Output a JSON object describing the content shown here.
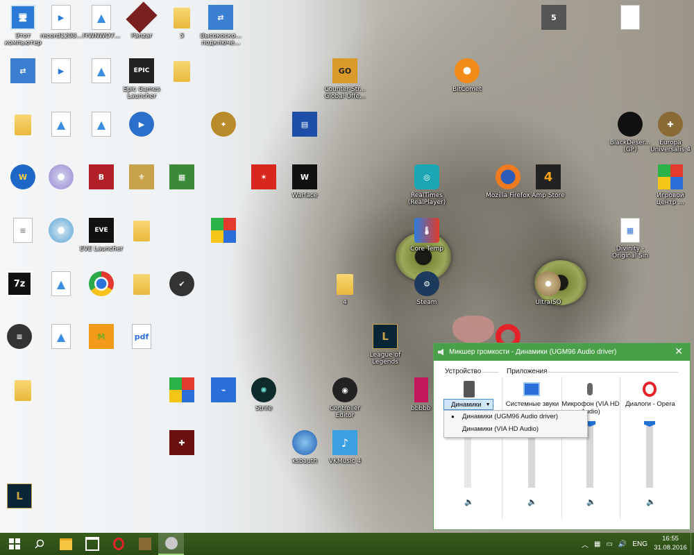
{
  "desktop": {
    "icons": [
      {
        "label": "Этот компьютер",
        "kind": "computer"
      },
      {
        "label": "record1208...",
        "kind": "video"
      },
      {
        "label": "FrWNWO7...",
        "kind": "photo"
      },
      {
        "label": "Panzar",
        "kind": "game"
      },
      {
        "label": "5",
        "kind": "folder"
      },
      {
        "label": "Высокоско... подключе...",
        "kind": "network"
      },
      {
        "label": "",
        "kind": "network"
      },
      {
        "label": "",
        "kind": "video"
      },
      {
        "label": "",
        "kind": "photo"
      },
      {
        "label": "Epic Games Launcher",
        "kind": "epic"
      },
      {
        "label": "",
        "kind": "folder"
      },
      {
        "label": "Counter-Str... Global Offe...",
        "kind": "csgo"
      },
      {
        "label": "BitComet",
        "kind": "bitcomet"
      },
      {
        "label": "",
        "kind": "folder"
      },
      {
        "label": "",
        "kind": "photo"
      },
      {
        "label": "",
        "kind": "photo"
      },
      {
        "label": "",
        "kind": "play"
      },
      {
        "label": "",
        "kind": "game"
      },
      {
        "label": "",
        "kind": "floppy"
      },
      {
        "label": "BlackDeser... (GP)",
        "kind": "game"
      },
      {
        "label": "Europa Universalis 4",
        "kind": "game"
      },
      {
        "label": "",
        "kind": "game"
      },
      {
        "label": "",
        "kind": "cd"
      },
      {
        "label": "",
        "kind": "game"
      },
      {
        "label": "",
        "kind": "game"
      },
      {
        "label": "",
        "kind": "game"
      },
      {
        "label": "",
        "kind": "game"
      },
      {
        "label": "Warface",
        "kind": "game"
      },
      {
        "label": "RealTimes (RealPlayer)",
        "kind": "realtimes"
      },
      {
        "label": "Mozilla Firefox",
        "kind": "firefox"
      },
      {
        "label": "Amp Store",
        "kind": "amp"
      },
      {
        "label": "Игровой центр ...",
        "kind": "rubik"
      },
      {
        "label": "",
        "kind": "doc"
      },
      {
        "label": "",
        "kind": "cd"
      },
      {
        "label": "EVE Launcher",
        "kind": "eve"
      },
      {
        "label": "",
        "kind": "folder"
      },
      {
        "label": "",
        "kind": "rubik"
      },
      {
        "label": "Core Temp",
        "kind": "coretemp"
      },
      {
        "label": "Divinity - Original Sin",
        "kind": "game"
      },
      {
        "label": "",
        "kind": "7z"
      },
      {
        "label": "",
        "kind": "photo"
      },
      {
        "label": "",
        "kind": "chrome"
      },
      {
        "label": "",
        "kind": "folder"
      },
      {
        "label": "",
        "kind": "app"
      },
      {
        "label": "4",
        "kind": "folder"
      },
      {
        "label": "Steam",
        "kind": "steam"
      },
      {
        "label": "UltraISO",
        "kind": "cd"
      },
      {
        "label": "",
        "kind": "app"
      },
      {
        "label": "",
        "kind": "photo"
      },
      {
        "label": "",
        "kind": "app"
      },
      {
        "label": "",
        "kind": "edgepdf"
      },
      {
        "label": "League of Legends",
        "kind": "lol"
      },
      {
        "label": "",
        "kind": "opera"
      },
      {
        "label": "",
        "kind": "folder"
      },
      {
        "label": "",
        "kind": "app"
      },
      {
        "label": "",
        "kind": "app"
      },
      {
        "label": "Strife",
        "kind": "game"
      },
      {
        "label": "Controller Editor",
        "kind": "app"
      },
      {
        "label": "bbbbb",
        "kind": "app"
      },
      {
        "label": "",
        "kind": "game"
      },
      {
        "label": "ksbauth",
        "kind": "app"
      },
      {
        "label": "VKMusic 4",
        "kind": "app"
      },
      {
        "label": "",
        "kind": "lol"
      },
      {
        "label": "",
        "kind": "doc"
      }
    ]
  },
  "mixer": {
    "title": "Микшер громкости - Динамики (UGM96 Audio driver)",
    "device_group": "Устройство",
    "apps_group": "Приложения",
    "device_button": "Динамики",
    "dropdown_options": [
      {
        "label": "Динамики (UGM96 Audio driver)",
        "selected": true
      },
      {
        "label": "Динамики (VIA HD Audio)",
        "selected": false
      }
    ],
    "channels": [
      {
        "label": "Системные звуки",
        "level": 0.95
      },
      {
        "label": "Микрофон (VIA HD Audio)",
        "level": 0.95
      },
      {
        "label": "Диалоги - Opera",
        "level": 0.95
      }
    ],
    "colors": {
      "titlebar": "#48a048",
      "accent": "#1e73d2"
    }
  },
  "taskbar": {
    "lang": "ENG",
    "time": "16:55",
    "date": "31.08.2016"
  }
}
